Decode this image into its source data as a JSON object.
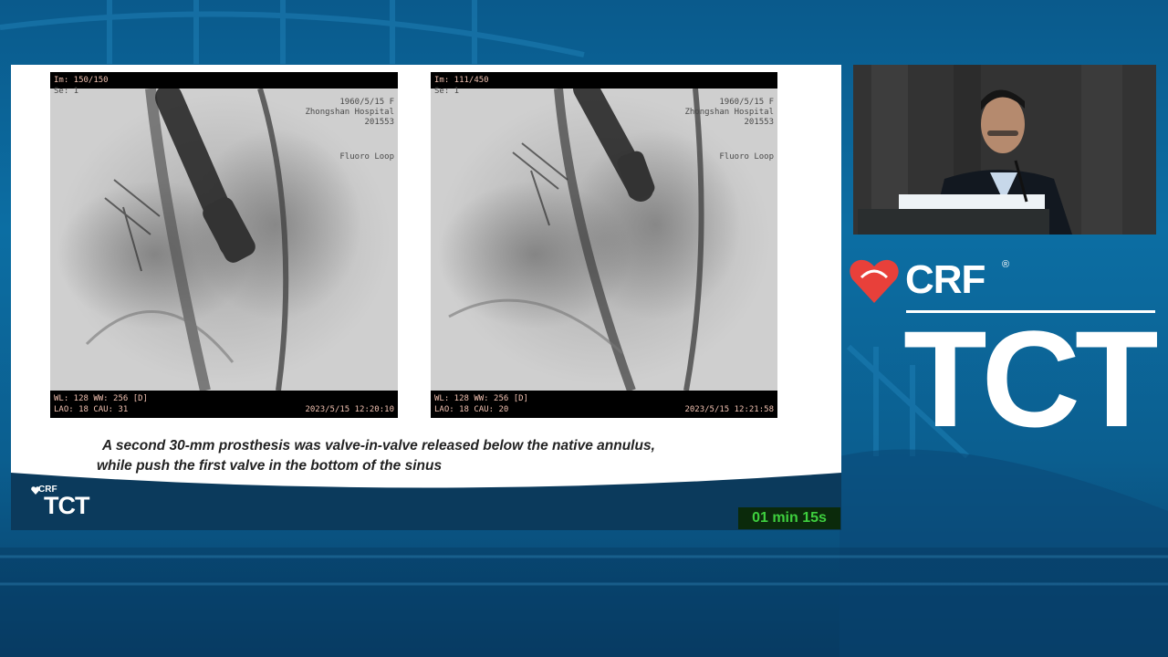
{
  "slide": {
    "left_image": {
      "im": "Im: 150/150",
      "se": "Se: 1",
      "patient": [
        "1960/5/15 F",
        "Zhongshan Hospital",
        "201553"
      ],
      "mode": "Fluoro Loop",
      "wl": "WL: 128 WW: 256 [D]",
      "angle": "LAO: 18 CAU: 31",
      "datetime": "2023/5/15 12:20:10"
    },
    "right_image": {
      "im": "Im: 111/450",
      "se": "Se: 1",
      "patient": [
        "1960/5/15 F",
        "Zhongshan Hospital",
        "201553"
      ],
      "mode": "Fluoro Loop",
      "wl": "WL: 128 WW: 256 [D]",
      "angle": "LAO: 18 CAU: 20",
      "datetime": "2023/5/15 12:21:58"
    },
    "caption_line1": "A second 30-mm prosthesis was valve-in-valve released below the native annulus,",
    "caption_line2": "while push the first valve in the bottom of the sinus",
    "footer_logo": {
      "crf": "CRF",
      "tct": "TCT"
    },
    "timer": "01 min 15s"
  },
  "brand": {
    "crf": "CRF",
    "registered": "®",
    "tct": "TCT",
    "heart_color": "#e8403a"
  }
}
